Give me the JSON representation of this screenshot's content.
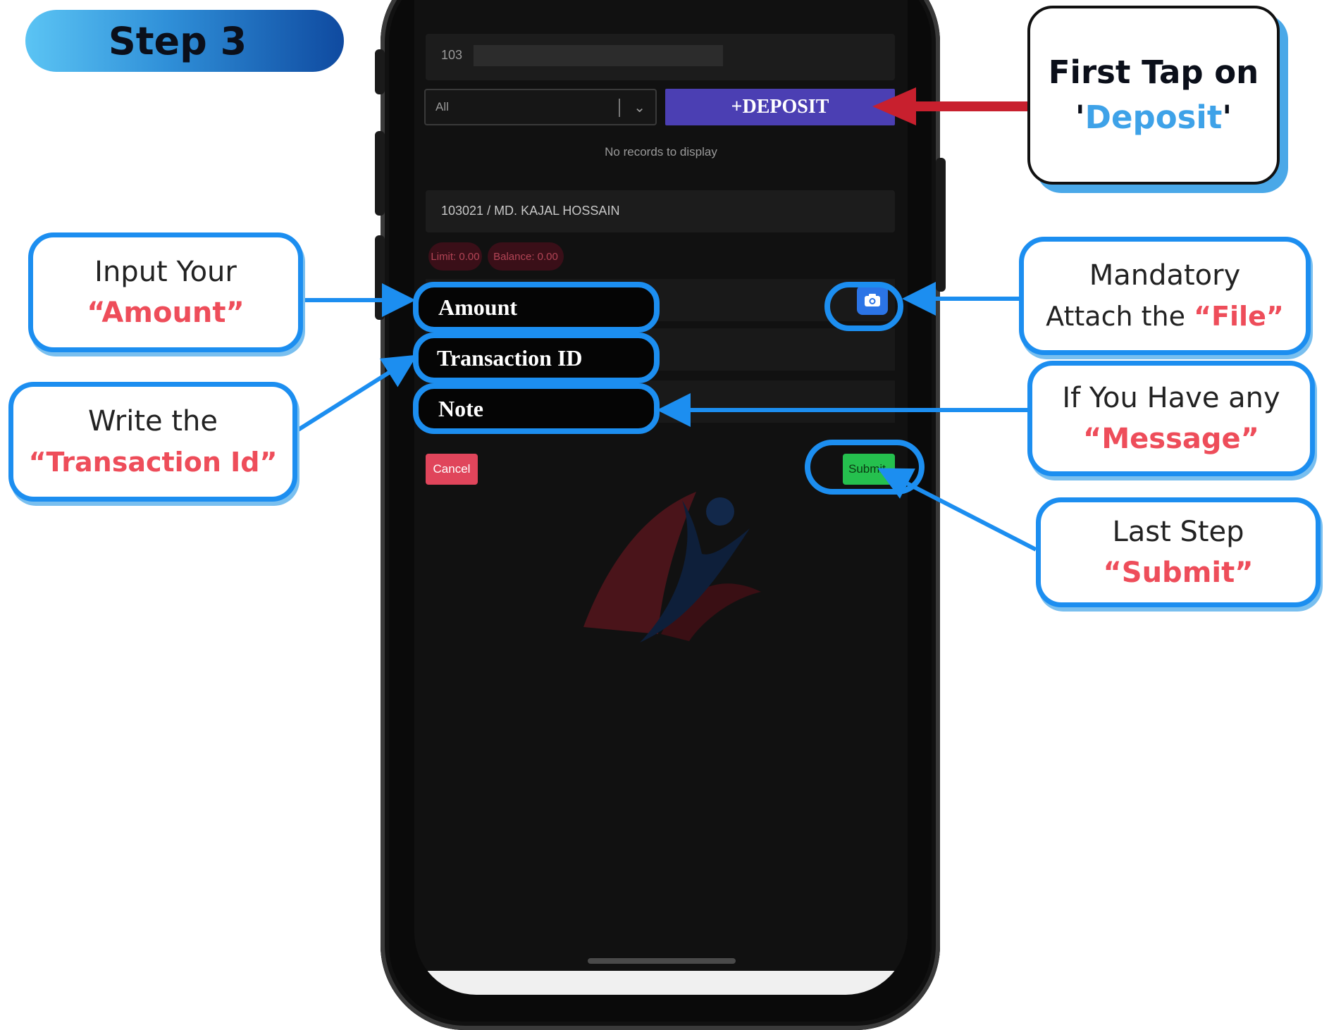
{
  "step": {
    "label": "Step 3"
  },
  "app": {
    "account_prefix": "103",
    "filter_value": "All",
    "deposit_label": "+DEPOSIT",
    "no_records": "No records to display",
    "account_name": "103021 / MD. KAJAL HOSSAIN",
    "limit": "Limit: 0.00",
    "balance": "Balance: 0.00",
    "fields": {
      "amount": "Amount",
      "transaction_id": "Transaction ID",
      "note": "Note"
    },
    "cancel_label": "Cancel",
    "submit_label": "Submit"
  },
  "callouts": {
    "deposit": {
      "line1": "First Tap on",
      "quote_open": "'",
      "highlight": "Deposit",
      "quote_close": "'"
    },
    "amount": {
      "line1": "Input Your",
      "highlight": "“Amount”"
    },
    "transaction": {
      "line1": "Write the",
      "highlight": "“Transaction Id”"
    },
    "file": {
      "line1": "Mandatory",
      "line2": "Attach the ",
      "highlight": "“File”"
    },
    "message": {
      "line1": "If You Have any",
      "highlight": "“Message”"
    },
    "submit": {
      "line1": "Last Step",
      "highlight": "“Submit”"
    }
  },
  "icons": {
    "camera": "camera-icon",
    "chevron": "chevron-down-icon"
  },
  "colors": {
    "accent_blue": "#1c8ef0",
    "deposit_button": "#4b3fb3",
    "arrow_red": "#c8202e",
    "highlight_red": "#ee4d5a",
    "submit_green": "#25c04e",
    "cancel_red": "#e0455b"
  }
}
